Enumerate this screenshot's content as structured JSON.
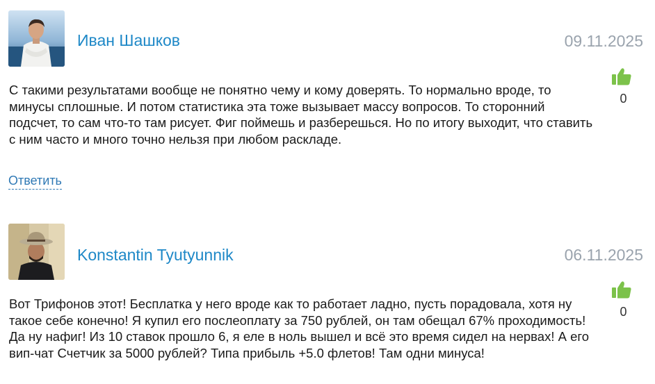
{
  "comments": [
    {
      "author": "Иван Шашков",
      "date": "09.11.2025",
      "likes": "0",
      "text": "С такими результатами вообще не понятно чему и кому доверять. То нормально вроде, то минусы сплошные. И потом статистика эта тоже вызывает массу вопросов. То сторонний подсчет, то сам что-то там рисует. Фиг поймешь и разберешься. Но по итогу выходит, что ставить с ним часто и много точно нельзя при любом раскладе.",
      "reply_label": "Ответить"
    },
    {
      "author": "Konstantin Tyutyunnik",
      "date": "06.11.2025",
      "likes": "0",
      "text": "Вот Трифонов этот! Бесплатка у него вроде как то работает ладно, пусть порадовала, хотя ну такое себе конечно! Я купил его послеоплату за 750 рублей, он там обещал 67% проходимость! Да ну нафиг! Из 10 ставок прошло 6, я еле в ноль вышел и всё это время сидел на нервах! А его вип-чат Счетчик за 5000 рублей? Типа прибыль +5.0 флетов! Там одни минуса!"
    }
  ],
  "icons": {
    "like": "thumbs-up-icon"
  },
  "colors": {
    "author_link": "#1e88c7",
    "date": "#9aa3ad",
    "like_icon": "#7cc24a",
    "reply_link": "#2f79b5"
  }
}
